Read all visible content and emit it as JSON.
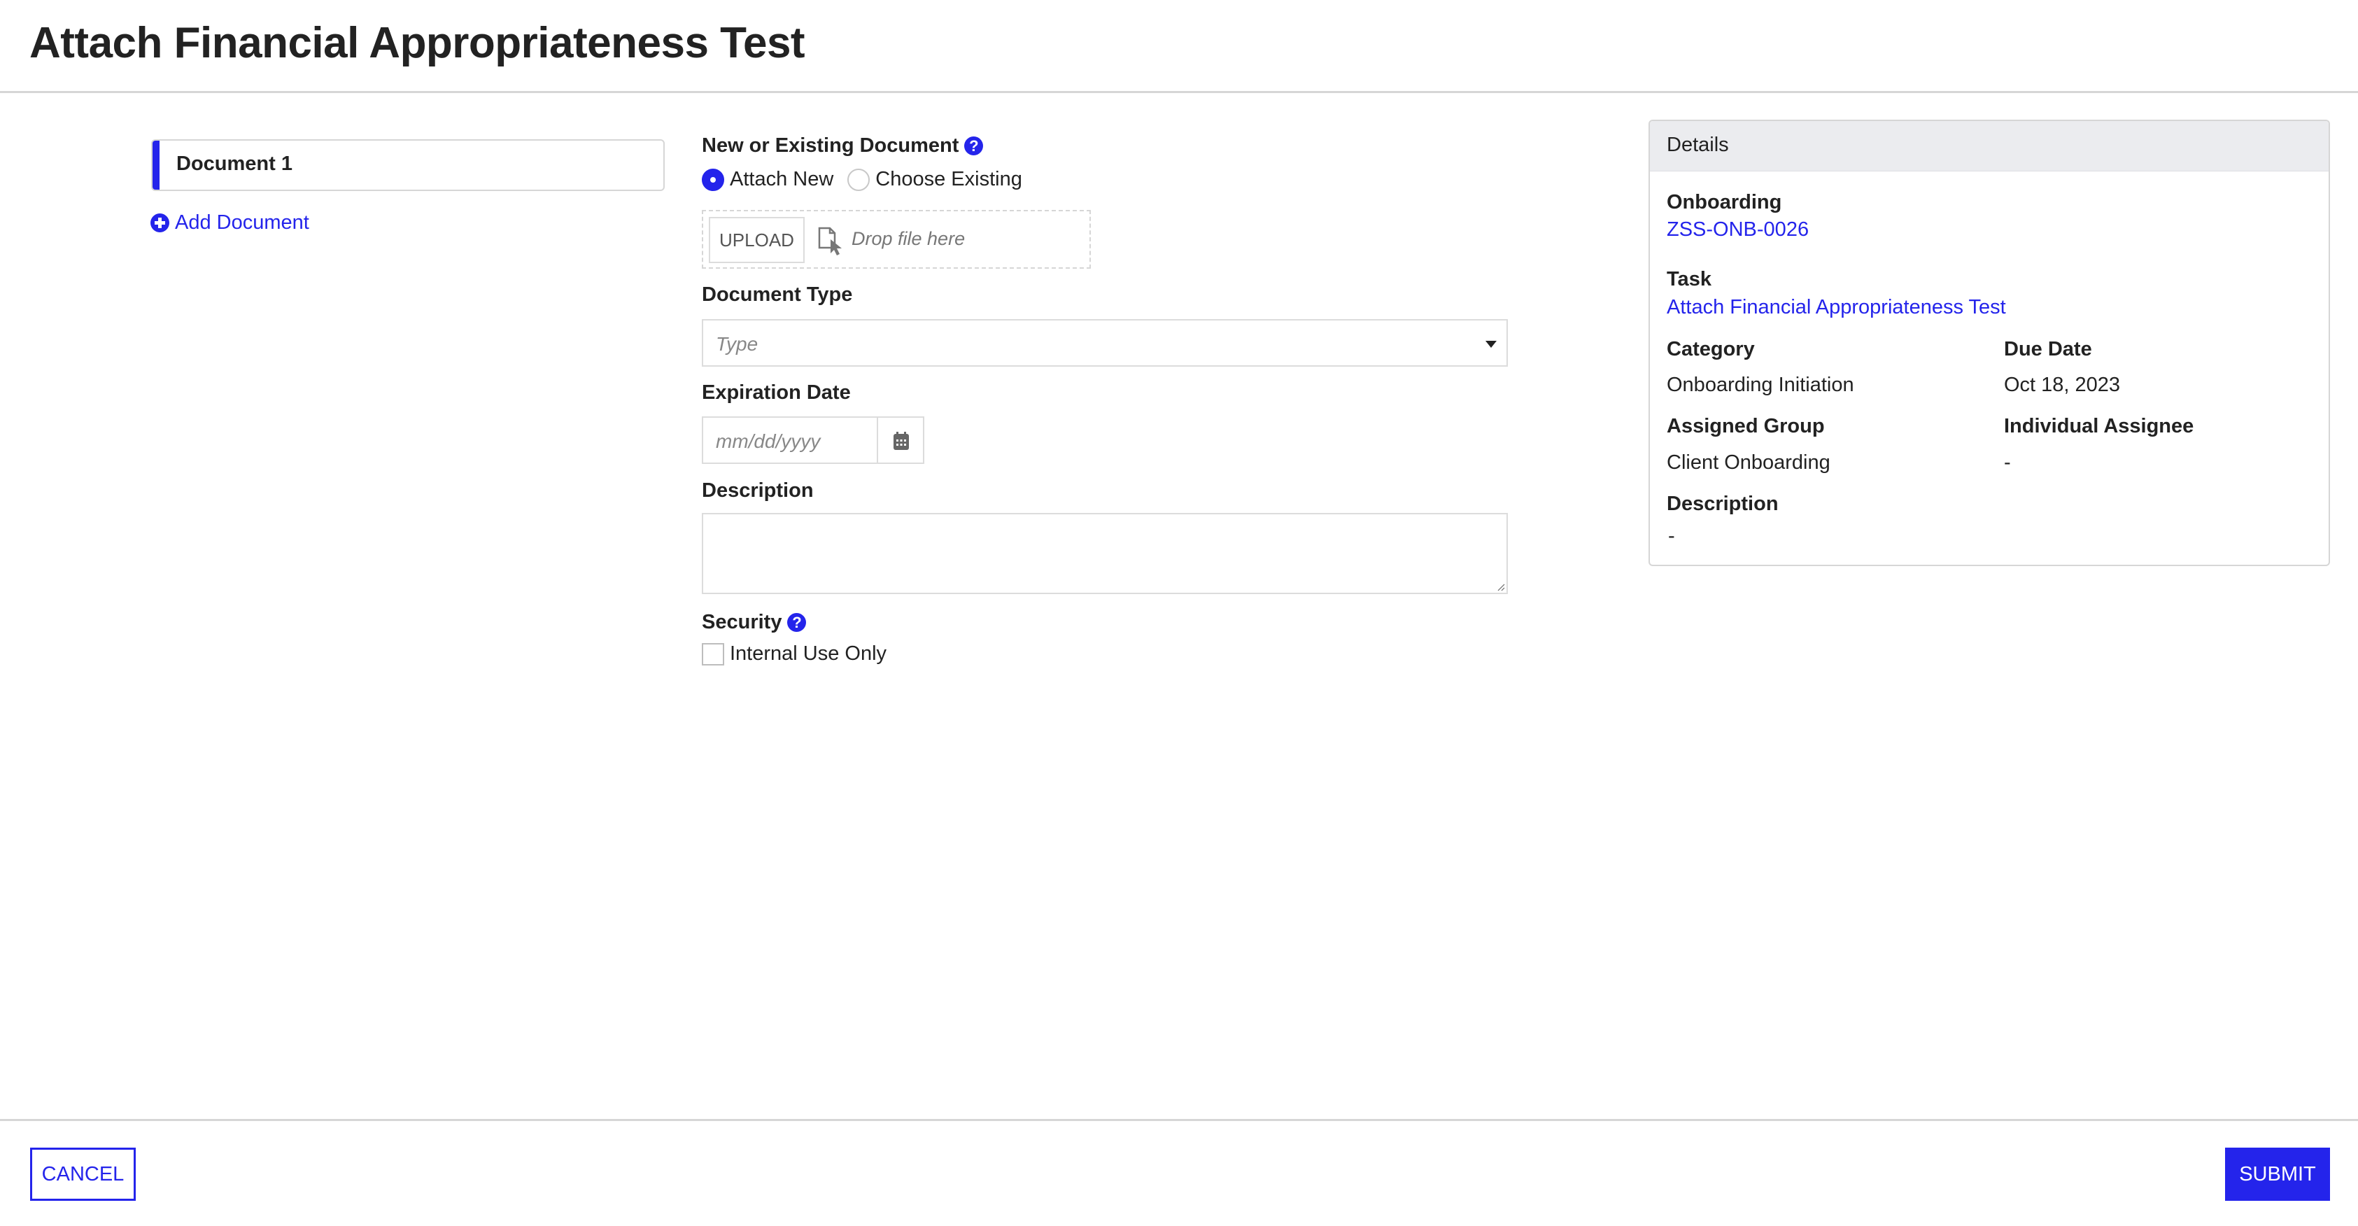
{
  "header": {
    "title": "Attach Financial Appropriateness Test"
  },
  "sidebar": {
    "documents": [
      {
        "label": "Document 1",
        "active": true
      }
    ],
    "add_document_label": "Add Document"
  },
  "form": {
    "source": {
      "label": "New or Existing Document",
      "options": [
        {
          "label": "Attach New",
          "checked": true
        },
        {
          "label": "Choose Existing",
          "checked": false
        }
      ]
    },
    "upload": {
      "button_label": "UPLOAD",
      "drop_text": "Drop file here"
    },
    "document_type": {
      "label": "Document Type",
      "placeholder": "Type",
      "value": ""
    },
    "expiration_date": {
      "label": "Expiration Date",
      "placeholder": "mm/dd/yyyy",
      "value": ""
    },
    "description": {
      "label": "Description",
      "value": ""
    },
    "security": {
      "label": "Security",
      "checkbox_label": "Internal Use Only",
      "checked": false
    }
  },
  "details": {
    "title": "Details",
    "onboarding": {
      "label": "Onboarding",
      "value": "ZSS-ONB-0026"
    },
    "task": {
      "label": "Task",
      "value": "Attach Financial Appropriateness Test"
    },
    "category": {
      "label": "Category",
      "value": "Onboarding Initiation"
    },
    "due_date": {
      "label": "Due Date",
      "value": "Oct 18, 2023"
    },
    "assigned_group": {
      "label": "Assigned Group",
      "value": "Client Onboarding"
    },
    "individual_assignee": {
      "label": "Individual Assignee",
      "value": "-"
    },
    "description": {
      "label": "Description",
      "value": "-"
    }
  },
  "footer": {
    "cancel_label": "CANCEL",
    "submit_label": "SUBMIT"
  },
  "colors": {
    "accent": "#2424eb",
    "border": "#d6d6d6",
    "details_header_bg": "#ebecef"
  }
}
